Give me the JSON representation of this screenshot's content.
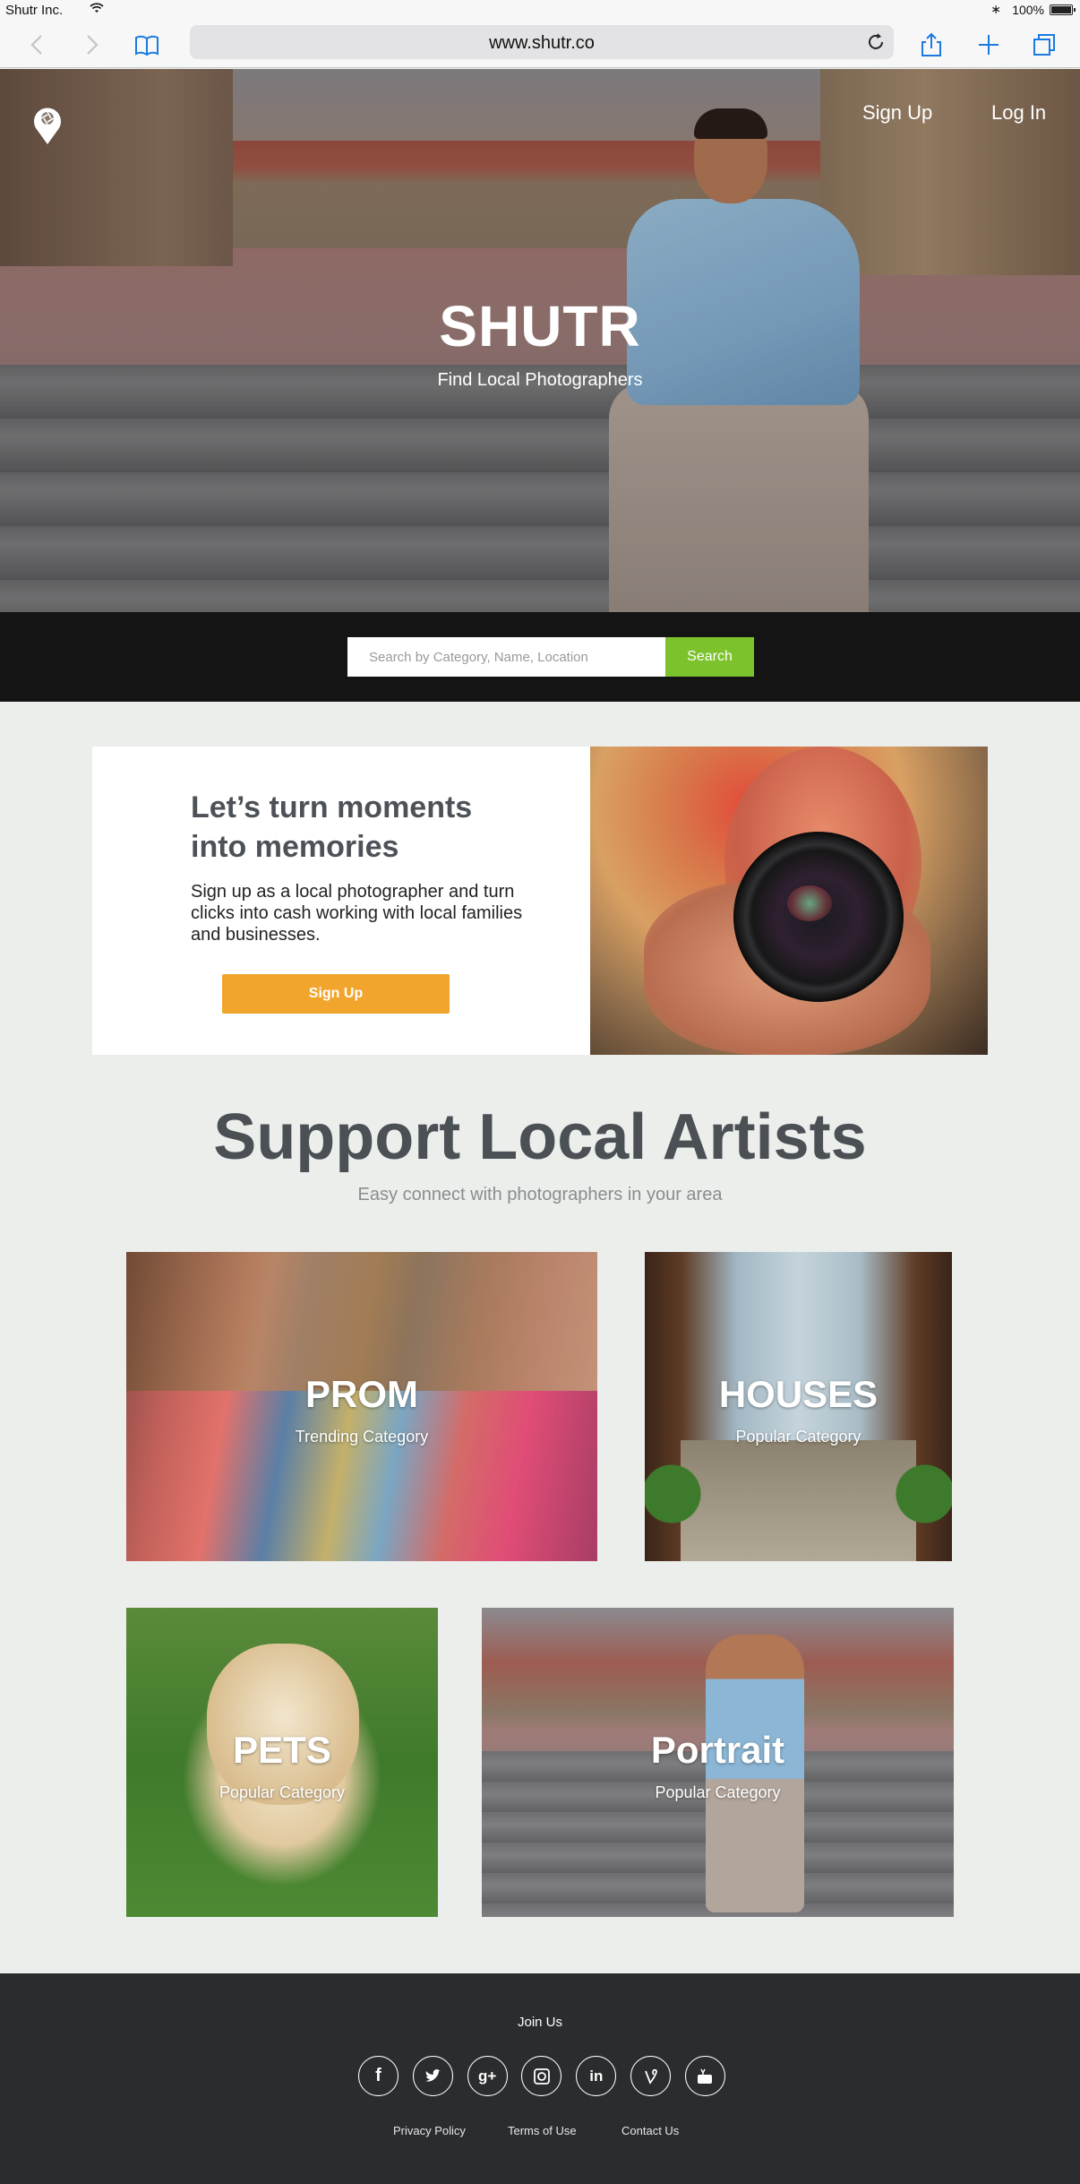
{
  "status_bar": {
    "carrier": "Shutr Inc.",
    "battery": "100%"
  },
  "browser": {
    "url": "www.shutr.co",
    "icons": [
      "back-icon",
      "forward-icon",
      "bookmarks-icon",
      "reload-icon",
      "share-icon",
      "new-tab-icon",
      "tabs-icon"
    ]
  },
  "hero": {
    "title": "SHUTR",
    "subtitle": "Find Local Photographers",
    "nav": {
      "signup": "Sign Up",
      "login": "Log In"
    },
    "search": {
      "placeholder": "Search by Category, Name, Location",
      "button": "Search"
    }
  },
  "promo": {
    "title": "Let’s turn moments into memories",
    "text": "Sign up as a local photographer and turn clicks into cash working with local families and businesses.",
    "button": "Sign Up"
  },
  "support": {
    "title": "Support Local Artists",
    "subtitle": "Easy connect with photographers in your area",
    "categories": [
      {
        "name": "PROM",
        "label": "Trending Category"
      },
      {
        "name": "HOUSES",
        "label": "Popular Category"
      },
      {
        "name": "PETS",
        "label": "Popular Category"
      },
      {
        "name": "Portrait",
        "label": "Popular Category"
      }
    ]
  },
  "footer": {
    "join": "Join Us",
    "socials": [
      "facebook-icon",
      "twitter-icon",
      "google-plus-icon",
      "instagram-icon",
      "linkedin-icon",
      "vine-icon",
      "youtube-icon"
    ],
    "links": {
      "privacy": "Privacy Policy",
      "terms": "Terms of Use",
      "contact": "Contact Us"
    }
  },
  "colors": {
    "search_button": "#7cc22c",
    "signup_button": "#f2a52c",
    "footer_bg": "#2b2c2e",
    "page_bg": "#eceeec"
  }
}
